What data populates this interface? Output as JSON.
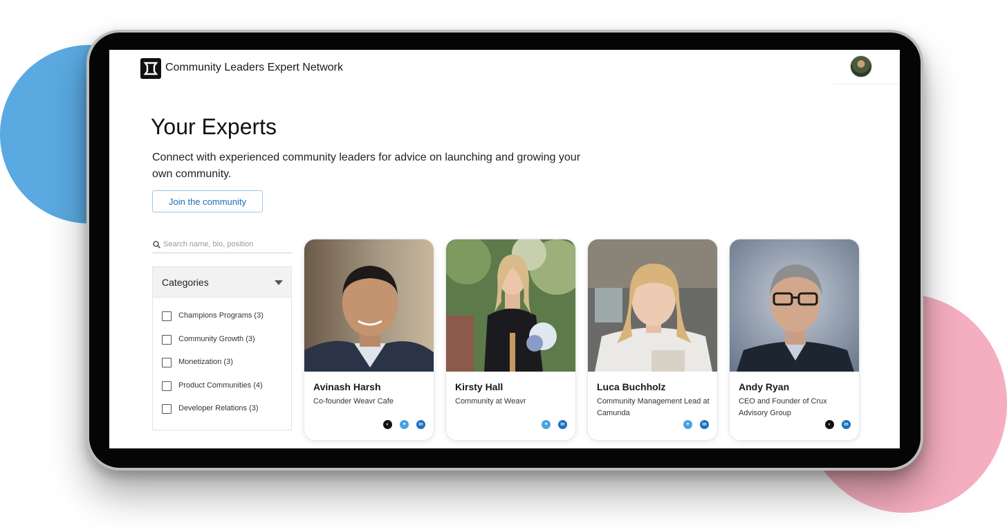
{
  "header": {
    "app_title": "Community Leaders Expert Network"
  },
  "hero": {
    "title": "Your Experts",
    "description": "Connect with experienced community leaders for advice on launching and growing your own community.",
    "join_label": "Join the community"
  },
  "search": {
    "placeholder": "Search name, bio, position",
    "value": ""
  },
  "categories": {
    "title": "Categories",
    "items": [
      {
        "label": "Champions Programs (3)"
      },
      {
        "label": "Community Growth (3)"
      },
      {
        "label": "Monetization (3)"
      },
      {
        "label": "Product Communities (4)"
      },
      {
        "label": "Developer Relations (3)"
      }
    ]
  },
  "experts": [
    {
      "name": "Avinash Harsh",
      "role": "Co-founder Weavr Cafe",
      "socials": [
        "globe-icon",
        "twitter-icon",
        "linkedin-icon"
      ]
    },
    {
      "name": "Kirsty Hall",
      "role": "Community at Weavr",
      "socials": [
        "twitter-icon",
        "linkedin-icon"
      ]
    },
    {
      "name": "Luca Buchholz",
      "role": "Community Management Lead at Camunda",
      "socials": [
        "twitter-icon",
        "linkedin-icon"
      ]
    },
    {
      "name": "Andy Ryan",
      "role": "CEO and Founder of Crux Advisory Group",
      "socials": [
        "globe-icon",
        "linkedin-icon"
      ]
    }
  ],
  "colors": {
    "accent": "#1d6fb8",
    "twitter": "#4aa3df",
    "linkedin": "#1a6fc0",
    "blob_blue": "#5aa9e0",
    "blob_pink": "#f5aebf"
  }
}
